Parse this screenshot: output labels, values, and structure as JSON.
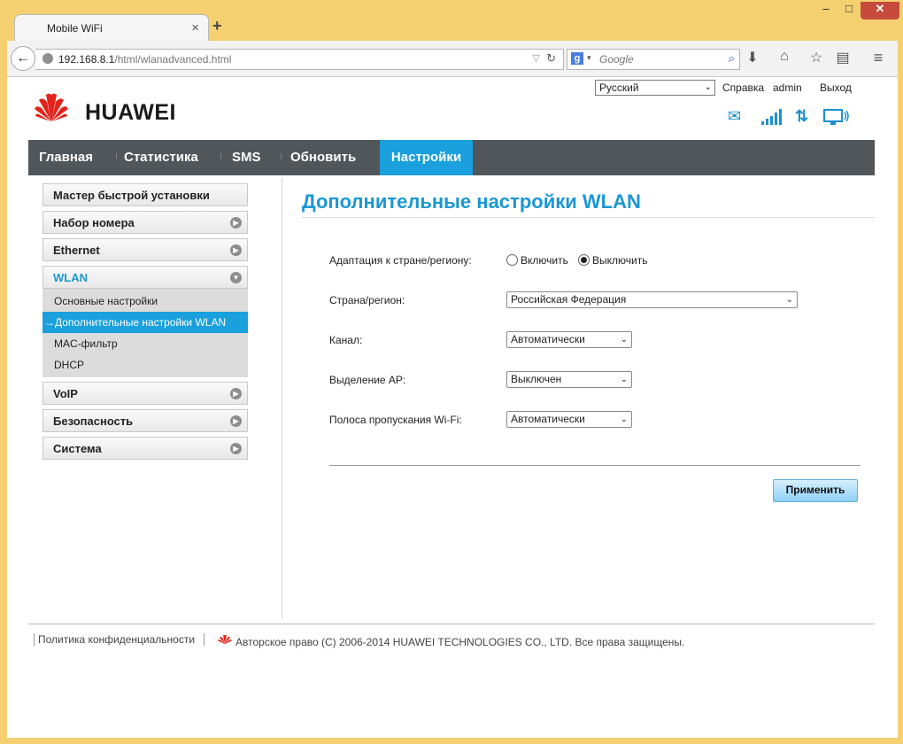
{
  "browser": {
    "tab_title": "Mobile WiFi",
    "tab_close": "×",
    "new_tab": "+",
    "url_host": "192.168.8.1",
    "url_path": "/html/wlanadvanced.html",
    "search_placeholder": "Google",
    "min": "–",
    "max": "□",
    "close": "✕"
  },
  "header": {
    "brand": "HUAWEI",
    "language": "Русский",
    "help": "Справка",
    "user": "admin",
    "logout": "Выход"
  },
  "nav": {
    "items": [
      "Главная",
      "Статистика",
      "SMS",
      "Обновить",
      "Настройки"
    ],
    "active": "Настройки"
  },
  "sidebar": {
    "items": [
      {
        "label": "Мастер быстрой установки"
      },
      {
        "label": "Набор номера"
      },
      {
        "label": "Ethernet"
      },
      {
        "label": "WLAN"
      },
      {
        "label": "VoIP"
      },
      {
        "label": "Безопасность"
      },
      {
        "label": "Система"
      }
    ],
    "wlan_sub": [
      "Основные настройки",
      "→Дополнительные настройки WLAN",
      "MAC-фильтр",
      "DHCP"
    ]
  },
  "main": {
    "title": "Дополнительные настройки WLAN",
    "fields": {
      "country_adapt_label": "Адаптация к стране/региону:",
      "enable": "Включить",
      "disable": "Выключить",
      "country_label": "Страна/регион:",
      "country_value": "Российская Федерация",
      "channel_label": "Канал:",
      "channel_value": "Автоматически",
      "ap_isolation_label": "Выделение AP:",
      "ap_isolation_value": "Выключен",
      "bandwidth_label": "Полоса пропускания Wi-Fi:",
      "bandwidth_value": "Автоматически"
    },
    "apply": "Применить"
  },
  "footer": {
    "privacy": "Политика конфиденциальности",
    "copyright": "Авторское право (C) 2006-2014 HUAWEI TECHNOLOGIES CO., LTD. Все права защищены."
  },
  "colors": {
    "accent": "#1aa0dc",
    "nav_bg": "#505659",
    "brand_red": "#e2231a"
  }
}
